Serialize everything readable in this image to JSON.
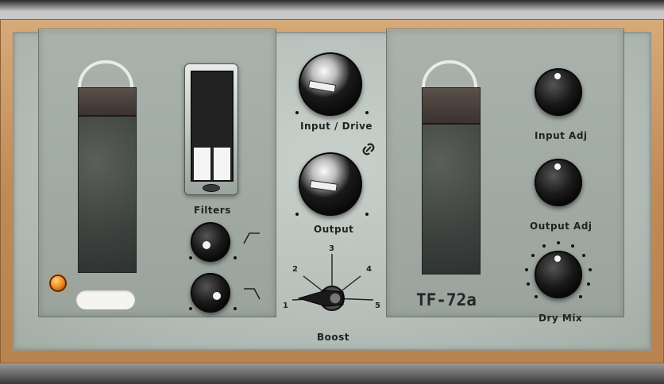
{
  "plugin": {
    "model_name": "TF-72a"
  },
  "left_section": {
    "filters_label": "Filters",
    "meter": {
      "left_level": 0.3,
      "right_level": 0.3
    }
  },
  "center_section": {
    "input_drive_label": "Input / Drive",
    "output_label": "Output",
    "boost_label": "Boost",
    "boost_positions": [
      "1",
      "2",
      "3",
      "4",
      "5"
    ]
  },
  "right_section": {
    "input_adj_label": "Input Adj",
    "output_adj_label": "Output Adj",
    "dry_mix_label": "Dry Mix"
  },
  "icons": {
    "link": "link-icon",
    "highpass": "highpass-filter-icon",
    "lowpass": "lowpass-filter-icon"
  },
  "colors": {
    "wood_frame": "#c08a55",
    "face_plate": "#b5beb8",
    "lamp_on": "#f08a1a",
    "knob_black": "#1a1a1a"
  }
}
